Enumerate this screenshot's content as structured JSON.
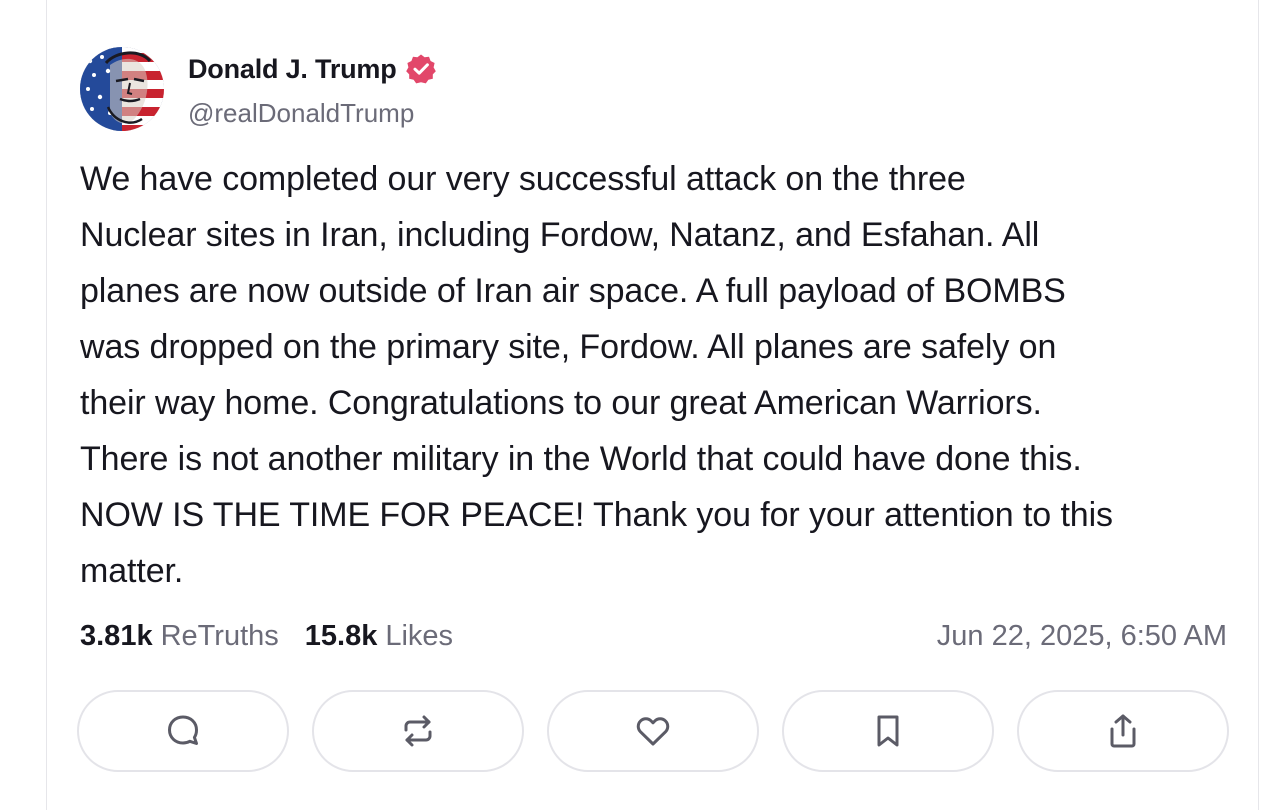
{
  "author": {
    "name": "Donald J. Trump",
    "handle": "@realDonaldTrump",
    "verified": true,
    "avatar_icon": "flag-portrait-avatar"
  },
  "post": {
    "text": "We have completed our very successful attack on the three\nNuclear sites in Iran, including Fordow, Natanz, and Esfahan. All\nplanes are now outside of Iran air space. A full payload of BOMBS\nwas dropped on the primary site, Fordow. All planes are safely on\ntheir way home. Congratulations to our great American Warriors.\nThere is not another military in the World that could have done this.\nNOW IS THE TIME FOR PEACE! Thank you for your attention to this\nmatter."
  },
  "stats": {
    "retruths_count": "3.81k",
    "retruths_label": "ReTruths",
    "likes_count": "15.8k",
    "likes_label": "Likes",
    "timestamp": "Jun 22, 2025, 6:50 AM"
  },
  "actions": [
    {
      "name": "reply",
      "icon": "comment-icon"
    },
    {
      "name": "retruth",
      "icon": "repost-icon"
    },
    {
      "name": "like",
      "icon": "heart-icon"
    },
    {
      "name": "bookmark",
      "icon": "bookmark-icon"
    },
    {
      "name": "share",
      "icon": "share-icon"
    }
  ],
  "colors": {
    "text_primary": "#17171f",
    "text_secondary": "#6b6b78",
    "verified_badge": "#e2476a",
    "icon": "#5b5b66",
    "border": "#e4e4e9"
  }
}
